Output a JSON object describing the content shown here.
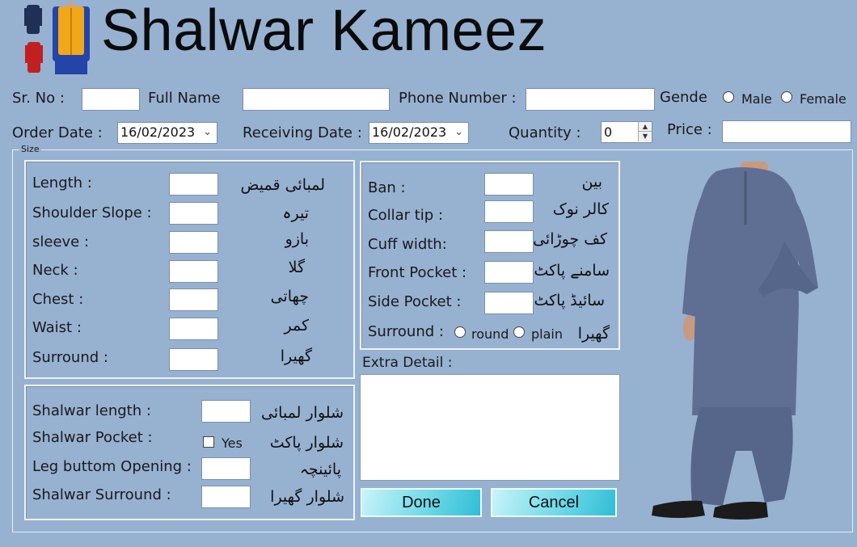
{
  "header": {
    "title": "Shalwar Kameez",
    "logo_icon": "shalwar-kameez-thumbnails"
  },
  "row1": {
    "sr_no_label": "Sr. No :",
    "full_name_label": "Full Name",
    "phone_label": "Phone Number :",
    "gender_label": "Gende",
    "male_label": "Male",
    "female_label": "Female"
  },
  "row2": {
    "order_date_label": "Order Date :",
    "order_date_value": "16/02/2023",
    "receiving_date_label": "Receiving  Date :",
    "receiving_date_value": "16/02/2023",
    "quantity_label": "Quantity :",
    "quantity_value": "0",
    "price_label": "Price :"
  },
  "size_group_label": "Size",
  "kameez": {
    "length": {
      "label": "Length :",
      "urdu": "لمبائی قمیض"
    },
    "shoulder": {
      "label": "Shoulder Slope :",
      "urdu": "تیرہ"
    },
    "sleeve": {
      "label": "sleeve :",
      "urdu": "بازو"
    },
    "neck": {
      "label": "Neck :",
      "urdu": "گلا"
    },
    "chest": {
      "label": "Chest :",
      "urdu": "چھاتی"
    },
    "waist": {
      "label": "Waist :",
      "urdu": "کمر"
    },
    "surround": {
      "label": "Surround :",
      "urdu": "گھیرا"
    }
  },
  "collar": {
    "ban": {
      "label": "Ban :",
      "urdu": "بین"
    },
    "collar_tip": {
      "label": "Collar tip :",
      "urdu": "کالر نوک"
    },
    "cuff": {
      "label": "Cuff width:",
      "urdu": "کف چوڑائی"
    },
    "front_pocket": {
      "label": "Front Pocket :",
      "urdu": "سامنے پاکٹ"
    },
    "side_pocket": {
      "label": "Side Pocket :",
      "urdu": "سائیڈ پاکٹ"
    },
    "surround": {
      "label": "Surround :",
      "round": "round",
      "plain": "plain",
      "urdu": "گھیرا"
    }
  },
  "shalwar": {
    "length": {
      "label": "Shalwar length :",
      "urdu": "شلوار لمبائی"
    },
    "pocket": {
      "label": "Shalwar Pocket :",
      "checkbox": "Yes",
      "urdu": "شلوار پاکٹ"
    },
    "leg": {
      "label": "Leg buttom Opening :",
      "urdu": "پائینچہ"
    },
    "surround": {
      "label": "Shalwar Surround :",
      "urdu": "شلوار گھیرا"
    }
  },
  "extra_detail_label": "Extra Detail :",
  "buttons": {
    "done": "Done",
    "cancel": "Cancel"
  },
  "colors": {
    "background": "#97b1d1",
    "button_gradient_end": "#2fbdd6",
    "suit": "#5f6f93"
  }
}
